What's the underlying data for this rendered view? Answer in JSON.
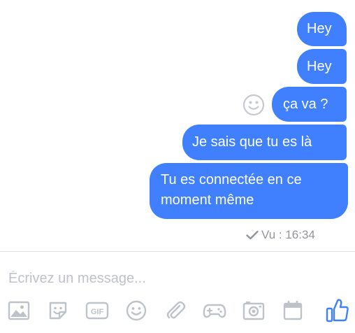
{
  "messages": [
    {
      "text": "Hey"
    },
    {
      "text": "Hey"
    },
    {
      "text": "ça va ?"
    },
    {
      "text": "Je sais que tu es là"
    },
    {
      "text": "Tu es connectée en ce moment même"
    }
  ],
  "status": {
    "seen_text": "Vu : 16:34"
  },
  "composer": {
    "placeholder": "Écrivez un message..."
  },
  "toolbar": {
    "items": [
      "photo-icon",
      "sticker-icon",
      "gif-icon",
      "emoji-icon",
      "attachment-icon",
      "game-icon",
      "camera-icon",
      "calendar-icon",
      "like-icon"
    ],
    "gif_label": "GIF"
  },
  "colors": {
    "bubble": "#4080ff",
    "icon": "#bec2c9",
    "like": "#4080ff",
    "muted_text": "#90949c"
  }
}
